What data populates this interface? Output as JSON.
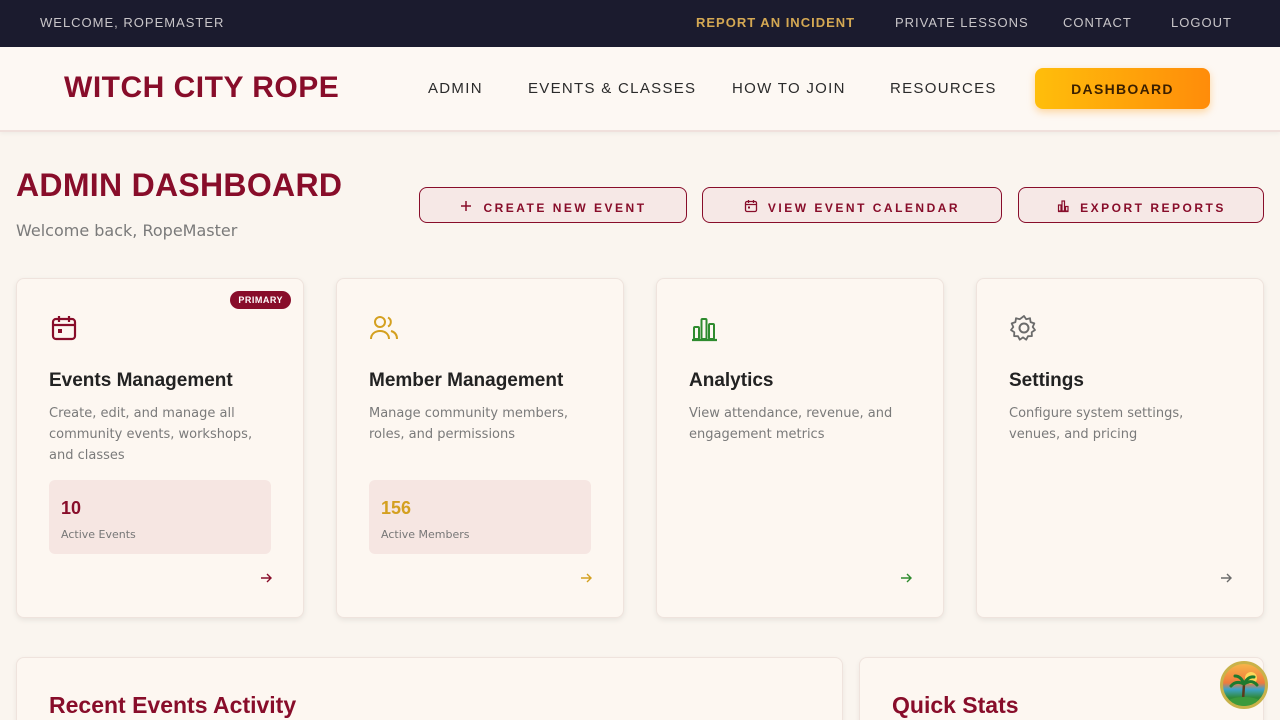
{
  "utility_bar": {
    "welcome": "WELCOME, ROPEMASTER",
    "links": [
      "REPORT AN INCIDENT",
      "PRIVATE LESSONS",
      "CONTACT",
      "LOGOUT"
    ]
  },
  "header": {
    "brand": "WITCH CITY ROPE",
    "nav": [
      "ADMIN",
      "EVENTS & CLASSES",
      "HOW TO JOIN",
      "RESOURCES"
    ],
    "dashboard_button": "DASHBOARD"
  },
  "page": {
    "title": "ADMIN DASHBOARD",
    "subtitle": "Welcome back, RopeMaster",
    "actions": [
      "CREATE NEW EVENT",
      "VIEW EVENT CALENDAR",
      "EXPORT REPORTS"
    ]
  },
  "cards": [
    {
      "title": "Events Management",
      "desc": "Create, edit, and manage all community events, workshops, and classes",
      "badge": "PRIMARY",
      "stat_value": "10",
      "stat_label": "Active Events",
      "icon": "calendar-icon",
      "color": "#880d2a"
    },
    {
      "title": "Member Management",
      "desc": "Manage community members, roles, and permissions",
      "stat_value": "156",
      "stat_label": "Active Members",
      "icon": "users-icon",
      "color": "#d4a020"
    },
    {
      "title": "Analytics",
      "desc": "View attendance, revenue, and engagement metrics",
      "icon": "bar-chart-icon",
      "color": "#2e8b2e"
    },
    {
      "title": "Settings",
      "desc": "Configure system settings, venues, and pricing",
      "icon": "gear-icon",
      "color": "#6b6b6b"
    }
  ],
  "panels": {
    "recent": "Recent Events Activity",
    "quick": "Quick Stats"
  }
}
